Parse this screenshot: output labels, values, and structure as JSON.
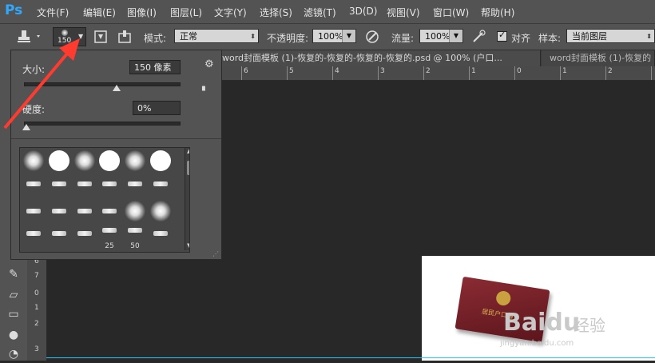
{
  "app": {
    "logo": "Ps"
  },
  "menu": [
    "文件(F)",
    "编辑(E)",
    "图像(I)",
    "图层(L)",
    "文字(Y)",
    "选择(S)",
    "滤镜(T)",
    "3D(D)",
    "视图(V)",
    "窗口(W)",
    "帮助(H)"
  ],
  "options": {
    "brush_size": "150",
    "mode_label": "模式:",
    "mode_value": "正常",
    "opacity_label": "不透明度:",
    "opacity_value": "100%",
    "flow_label": "流量:",
    "flow_value": "100%",
    "align_label": "对齐",
    "sample_label": "样本:",
    "sample_value": "当前图层"
  },
  "tabs": [
    "word封面模板 (1)-恢复的-恢复的-恢复的-恢复的.psd @ 100% (户口...",
    "word封面模板 (1)-恢复的"
  ],
  "ruler_h": [
    "6",
    "5",
    "4",
    "3",
    "2",
    "1",
    "0",
    "1",
    "2",
    "3",
    "4",
    "5",
    "6",
    "7",
    "8"
  ],
  "ruler_v": [
    "6",
    "7",
    "0",
    "1",
    "2",
    "3"
  ],
  "brush_panel": {
    "size_label": "大小:",
    "size_value": "150 像素",
    "size_level": 0.6,
    "hardness_label": "硬度:",
    "hardness_value": "0%",
    "hardness_level": 0.0,
    "preset_labels": [
      "25",
      "50"
    ]
  },
  "canvas": {
    "emblem_text": "居民户口簿",
    "watermark": "Baidu",
    "watermark_cn": "经验",
    "watermark_url": "jingyan.baidu.com"
  },
  "colors": {
    "accent": "#31a8ff",
    "arrow": "#ff3b30",
    "guide": "#26c6ff"
  }
}
